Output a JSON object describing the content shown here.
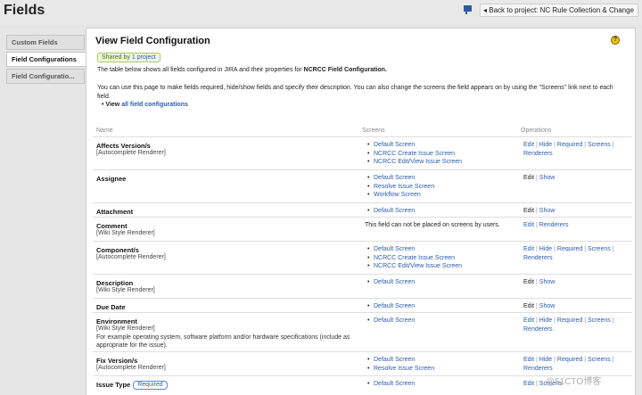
{
  "header": {
    "title": "Fields",
    "back_link": "Back to project: NC Rule Collection & Change"
  },
  "sidebar": {
    "tabs": [
      {
        "label": "Custom Fields"
      },
      {
        "label": "Field Configurations"
      },
      {
        "label": "Field Configuratio..."
      }
    ]
  },
  "panel": {
    "title": "View Field Configuration",
    "shared_prefix": "Shared by",
    "shared_link": "1 project",
    "intro_text": "The table below shows all fields configured in JIRA and their properties for",
    "intro_name": "NCRCC Field Configuration.",
    "instructions": "You can use this page to make fields required, hide/show fields and specify their description. You can also change the screens the field appears on by using the \"Screens\" link next to each field.",
    "view_prefix": "View",
    "view_link": "all field configurations"
  },
  "table": {
    "columns": {
      "name": "Name",
      "screens": "Screens",
      "operations": "Operations"
    },
    "rows": [
      {
        "name": "Affects Version/s",
        "renderer": "[Autocomplete Renderer]",
        "screens": [
          "Default Screen",
          "NCRCC Create Issue Screen",
          "NCRCC Edit/View Issue Screen"
        ],
        "ops": [
          "Edit",
          "Hide",
          "Required",
          "Screens",
          "Renderers"
        ]
      },
      {
        "name": "Assignee",
        "screens": [
          "Default Screen",
          "Resolve Issue Screen",
          "Workflow Screen"
        ],
        "ops": [
          "Edit",
          "Show"
        ]
      },
      {
        "name": "Attachment",
        "screens": [
          "Default Screen"
        ],
        "ops": [
          "Edit",
          "Show"
        ]
      },
      {
        "name": "Comment",
        "renderer": "[Wiki Style Renderer]",
        "screen_note": "This field can not be placed on screens by users.",
        "ops": [
          "Edit",
          "Renderers"
        ]
      },
      {
        "name": "Component/s",
        "renderer": "[Autocomplete Renderer]",
        "screens": [
          "Default Screen",
          "NCRCC Create Issue Screen",
          "NCRCC Edit/View Issue Screen"
        ],
        "ops": [
          "Edit",
          "Hide",
          "Required",
          "Screens",
          "Renderers"
        ]
      },
      {
        "name": "Description",
        "renderer": "[Wiki Style Renderer]",
        "screens": [
          "Default Screen"
        ],
        "ops": [
          "Edit",
          "Show"
        ]
      },
      {
        "name": "Due Date",
        "screens": [
          "Default Screen"
        ],
        "ops": [
          "Edit",
          "Show"
        ]
      },
      {
        "name": "Environment",
        "renderer": "[Wiki Style Renderer]",
        "description": "For example operating system, software platform and/or hardware specifications (include as appropriate for the issue).",
        "screens": [
          "Default Screen"
        ],
        "ops": [
          "Edit",
          "Hide",
          "Required",
          "Screens",
          "Renderers"
        ]
      },
      {
        "name": "Fix Version/s",
        "renderer": "[Autocomplete Renderer]",
        "screens": [
          "Default Screen",
          "Resolve Issue Screen"
        ],
        "ops": [
          "Edit",
          "Hide",
          "Required",
          "Screens",
          "Renderers"
        ]
      },
      {
        "name": "Issue Type",
        "badge": "Required",
        "screens": [
          "Default Screen"
        ],
        "ops": [
          "Edit",
          "Screens"
        ]
      }
    ]
  },
  "watermark": "@51CTO博客"
}
